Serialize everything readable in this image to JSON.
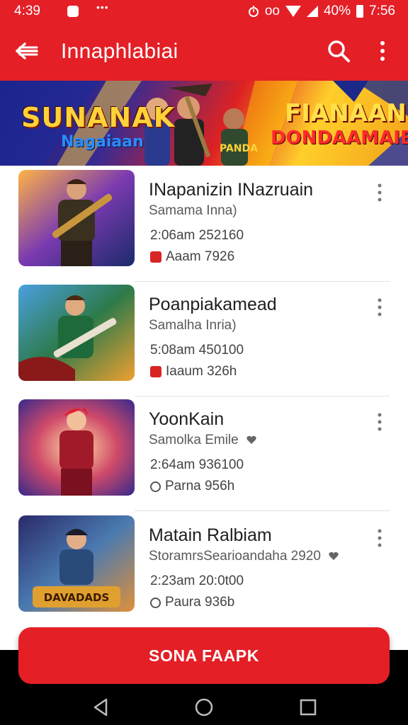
{
  "status_bar": {
    "time_left": "4:39",
    "dots": "•••",
    "icon_left": "notification-icon",
    "icon_right": "alarm-icon",
    "network": "oo",
    "battery_pct": "40%",
    "time_right": "7:56"
  },
  "app_bar": {
    "title": "Innaphlabiai",
    "back_icon": "arrow-left-icon",
    "search_icon": "search-icon",
    "more_icon": "more-vertical-icon",
    "color": "#e41f26"
  },
  "banner": {
    "logo_title": "SUNANAK",
    "logo_subtitle": "Nagaiaan",
    "right_title_1": "FIANAAN",
    "right_title_2": "DONDAAMAIE!!",
    "center_text": "PANDA"
  },
  "items": [
    {
      "name": "INapanizin INazruain",
      "subtitle": "Samama Inna)",
      "meta1": "2:06am  252160",
      "meta2": "Aaam  7926",
      "meta2_icon": "red-tag-icon",
      "show_heart": false
    },
    {
      "name": "Poanpiakamead",
      "subtitle": "Samalha Inria)",
      "meta1": "5:08am  450100",
      "meta2": "Iaaum  326h",
      "meta2_icon": "red-tag-icon",
      "show_heart": false
    },
    {
      "name": "YoonKain",
      "subtitle": "Samolka Emile",
      "meta1": "2:64am  936100",
      "meta2": "Parna  956h",
      "meta2_icon": "clock-icon",
      "show_heart": true
    },
    {
      "name": "Matain Ralbiam",
      "subtitle": "StoramrsSearioandaha 2920",
      "meta1": "2:23am  20:0t00",
      "meta2": "Paura  936b",
      "meta2_icon": "clock-icon",
      "show_heart": true
    }
  ],
  "cta": {
    "label": "SONA FAAPK"
  },
  "nav_bar": {
    "back": "nav-back-icon",
    "home": "nav-home-icon",
    "recents": "nav-recents-icon"
  }
}
